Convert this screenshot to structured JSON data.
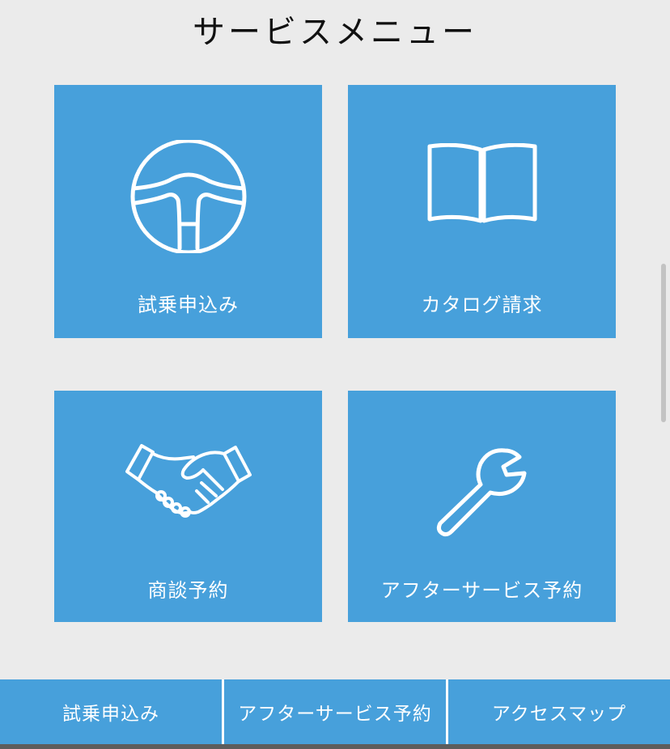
{
  "page": {
    "title": "サービスメニュー"
  },
  "tiles": [
    {
      "label": "試乗申込み",
      "icon": "steering-wheel-icon"
    },
    {
      "label": "カタログ請求",
      "icon": "open-book-icon"
    },
    {
      "label": "商談予約",
      "icon": "handshake-icon"
    },
    {
      "label": "アフターサービス予約",
      "icon": "wrench-icon"
    }
  ],
  "bottom_nav": [
    {
      "label": "試乗申込み"
    },
    {
      "label": "アフターサービス予約"
    },
    {
      "label": "アクセスマップ"
    }
  ],
  "colors": {
    "background": "#ebebeb",
    "tile": "#47a0db",
    "tile_text": "#ffffff",
    "title_text": "#111111",
    "bottom_strip": "#5d5d5d"
  }
}
